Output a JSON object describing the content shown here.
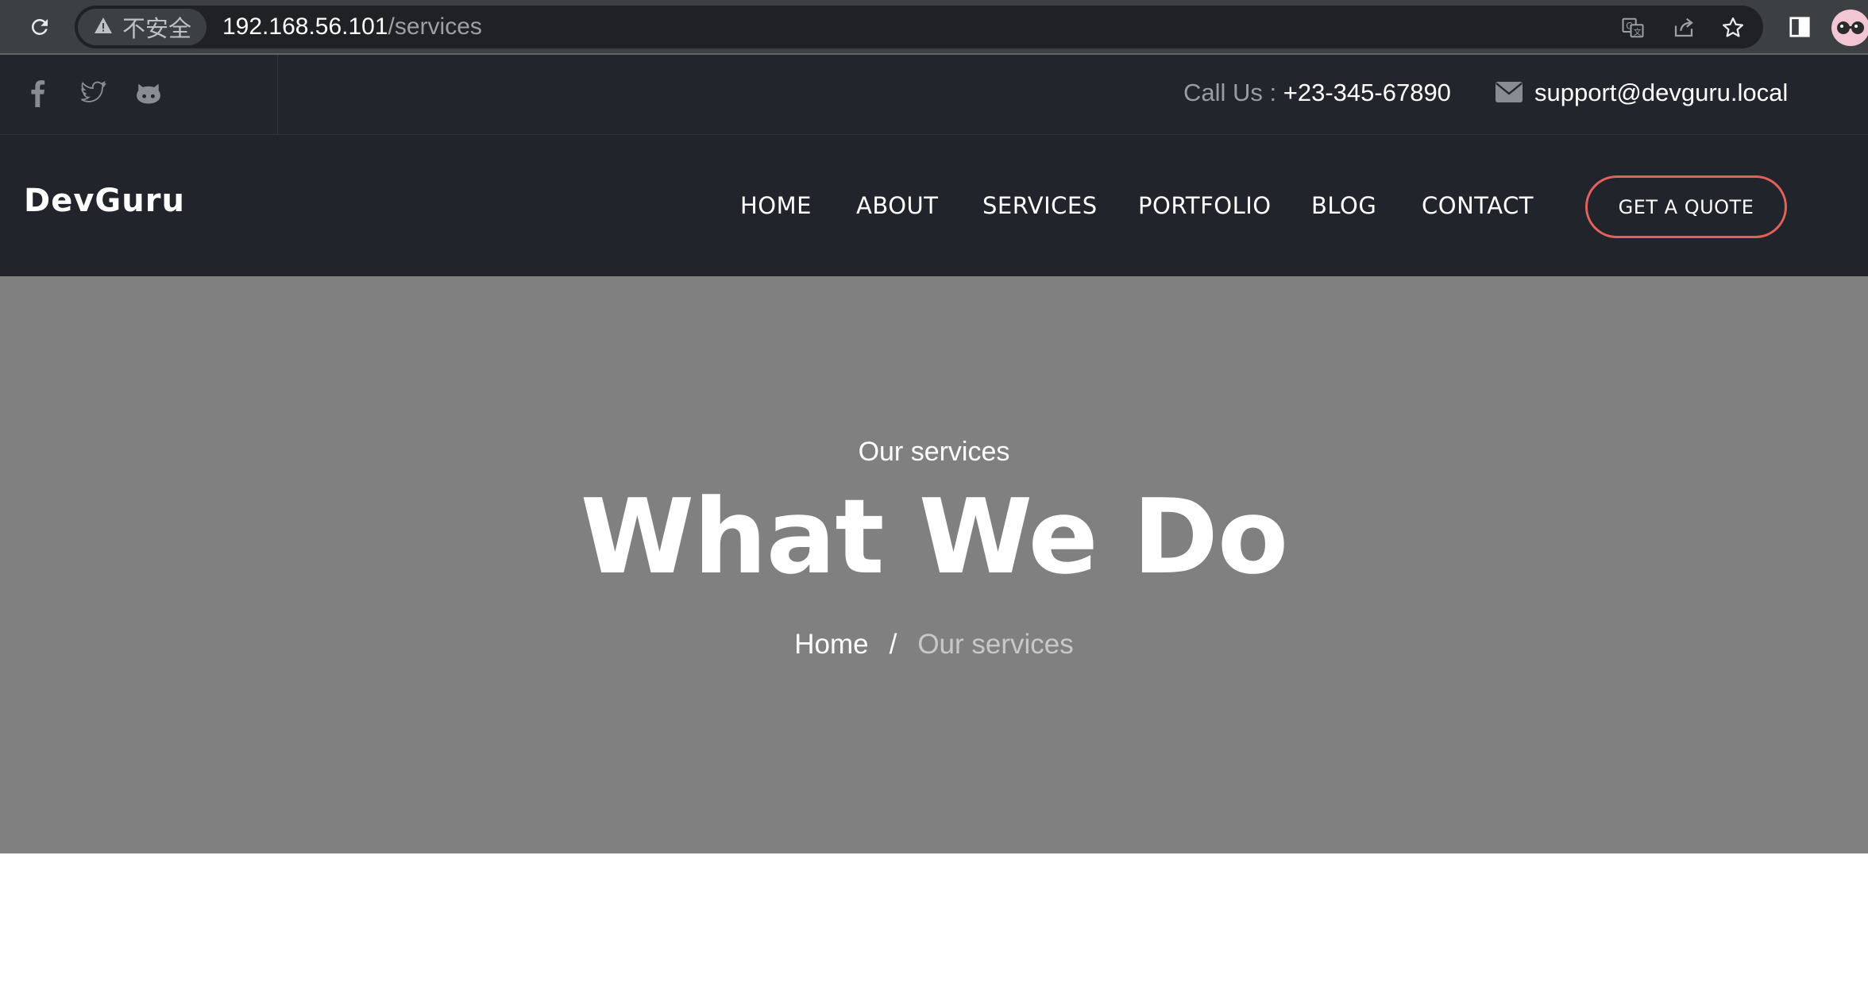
{
  "browser": {
    "security_label": "不安全",
    "url_host": "192.168.56.101",
    "url_path": "/services"
  },
  "topbar": {
    "social": [
      "facebook-icon",
      "twitter-icon",
      "github-icon"
    ],
    "call_label": "Call Us :",
    "phone": "+23-345-67890",
    "email": "support@devguru.local"
  },
  "nav": {
    "logo": "DevGuru",
    "items": [
      "HOME",
      "ABOUT",
      "SERVICES",
      "PORTFOLIO",
      "BLOG",
      "CONTACT"
    ],
    "quote_label": "GET A QUOTE"
  },
  "hero": {
    "subtitle": "Our services",
    "title": "What We Do",
    "breadcrumb_home": "Home",
    "breadcrumb_sep": "/",
    "breadcrumb_current": "Our services"
  },
  "colors": {
    "accent": "#e2625b",
    "dark_bg": "#23252c",
    "hero_bg": "#808080"
  }
}
